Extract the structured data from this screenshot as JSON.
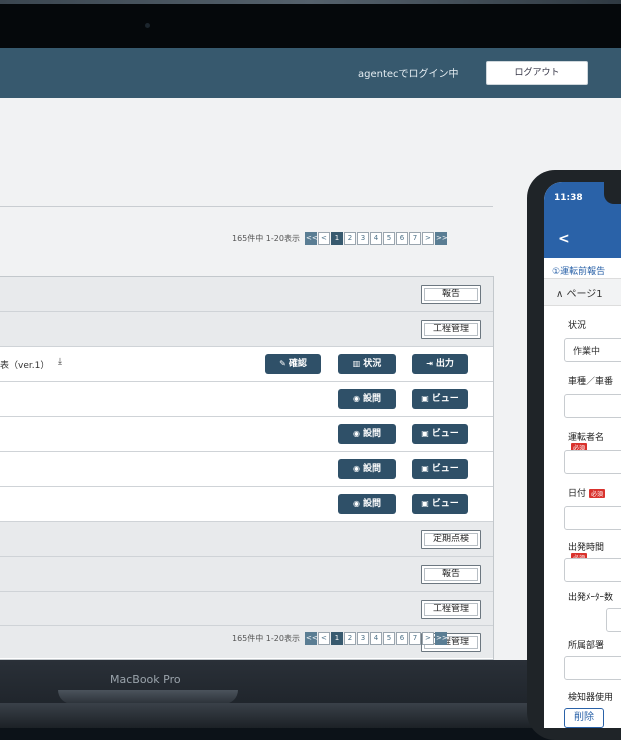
{
  "header": {
    "login_status": "agentecでログイン中",
    "logout_label": "ログアウト"
  },
  "pagination": {
    "count_text": "165件中 1-20表示",
    "first": "<<",
    "prev": "<",
    "next": ">",
    "last": ">>",
    "pages": [
      "1",
      "2",
      "3",
      "4",
      "5",
      "6",
      "7"
    ],
    "current": "1"
  },
  "table": {
    "rows": [
      {
        "button": "報告"
      },
      {
        "button": "工程管理"
      },
      {
        "text": "表（ver.1）",
        "actions": [
          "確認",
          "状況",
          "出力"
        ]
      },
      {
        "actions": [
          "設問",
          "ビュー"
        ]
      },
      {
        "actions": [
          "設問",
          "ビュー"
        ]
      },
      {
        "actions": [
          "設問",
          "ビュー"
        ]
      },
      {
        "actions": [
          "設問",
          "ビュー"
        ]
      },
      {
        "button": "定期点検"
      },
      {
        "button": "報告"
      },
      {
        "button": "工程管理"
      },
      {
        "button": "工程管理"
      }
    ]
  },
  "laptop": {
    "model_label": "MacBook Pro"
  },
  "phone": {
    "time": "11:38",
    "back": "<",
    "report_title": "①運転前報告",
    "section": "ページ1",
    "fields": [
      {
        "label": "状況",
        "value": "作業中"
      },
      {
        "label": "車種／車番",
        "value": ""
      },
      {
        "label": "運転者名",
        "value": "",
        "required": "必須"
      },
      {
        "label": "日付",
        "value": "",
        "required": "必須"
      },
      {
        "label": "出発時間",
        "value": "",
        "required": "必須"
      },
      {
        "label": "出発ﾒｰﾀｰ数",
        "value": ""
      },
      {
        "label": "所属部署",
        "value": ""
      },
      {
        "label": "検知器使用",
        "value": ""
      }
    ],
    "delete_label": "削除"
  },
  "colors": {
    "header": "#37596e",
    "accent": "#2f5068",
    "phone_bar": "#2a62a8"
  }
}
